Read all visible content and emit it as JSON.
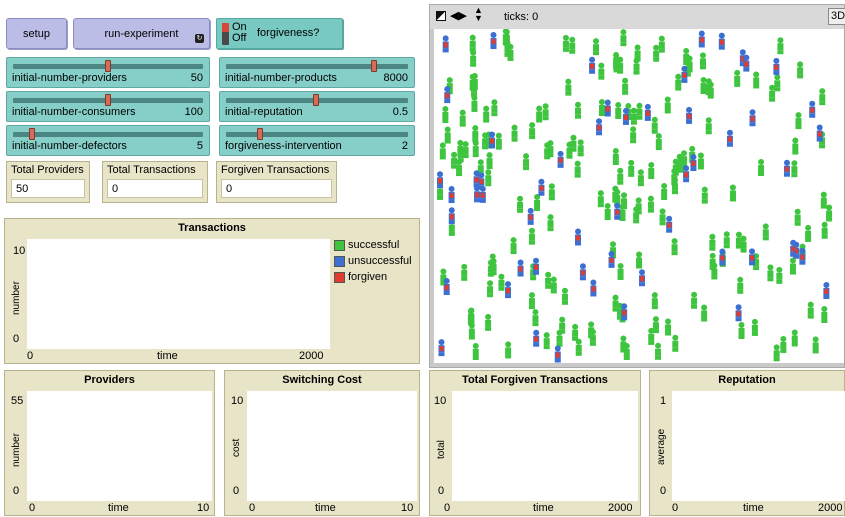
{
  "buttons": {
    "setup": "setup",
    "run_experiment": "run-experiment"
  },
  "switch": {
    "on_label": "On",
    "off_label": "Off",
    "label": "forgiveness?",
    "state": "on"
  },
  "sliders": [
    {
      "label": "initial-number-providers",
      "value": "50",
      "fraction": 0.5
    },
    {
      "label": "initial-number-products",
      "value": "8000",
      "fraction": 0.8
    },
    {
      "label": "initial-number-consumers",
      "value": "100",
      "fraction": 0.5
    },
    {
      "label": "initial-reputation",
      "value": "0.5",
      "fraction": 0.5
    },
    {
      "label": "initial-number-defectors",
      "value": "5",
      "fraction": 0.05
    },
    {
      "label": "forgiveness-intervention",
      "value": "2",
      "fraction": 0.2
    }
  ],
  "monitors": [
    {
      "label": "Total Providers",
      "value": "50"
    },
    {
      "label": "Total Transactions",
      "value": "0"
    },
    {
      "label": "Forgiven Transactions",
      "value": "0"
    }
  ],
  "world": {
    "ticks_label": "ticks: 0",
    "view_button": "3D"
  },
  "plots": {
    "transactions": {
      "title": "Transactions",
      "ylabel": "number",
      "xlabel": "time",
      "xmin": "0",
      "xmax": "2000",
      "ymin": "0",
      "ymax": "10",
      "legend": [
        {
          "name": "successful",
          "color": "#3ec43e"
        },
        {
          "name": "unsuccessful",
          "color": "#3b6fd1"
        },
        {
          "name": "forgiven",
          "color": "#e23b30"
        }
      ]
    },
    "providers": {
      "title": "Providers",
      "ylabel": "number",
      "xlabel": "time",
      "xmin": "0",
      "xmax": "10",
      "ymin": "0",
      "ymax": "55"
    },
    "switching_cost": {
      "title": "Switching Cost",
      "ylabel": "cost",
      "xlabel": "time",
      "xmin": "0",
      "xmax": "10",
      "ymin": "0",
      "ymax": "10"
    },
    "forgiven_total": {
      "title": "Total Forgiven Transactions",
      "ylabel": "total",
      "xlabel": "time",
      "xmin": "0",
      "xmax": "2000",
      "ymin": "0",
      "ymax": "10"
    },
    "reputation": {
      "title": "Reputation",
      "ylabel": "average",
      "xlabel": "time",
      "xmin": "0",
      "xmax": "2000",
      "ymin": "0",
      "ymax": "1"
    }
  },
  "colors": {
    "consumer_agent": "#3ec43e",
    "provider_agent": "#3b6fd1",
    "provider_badge": "#e23b30"
  }
}
